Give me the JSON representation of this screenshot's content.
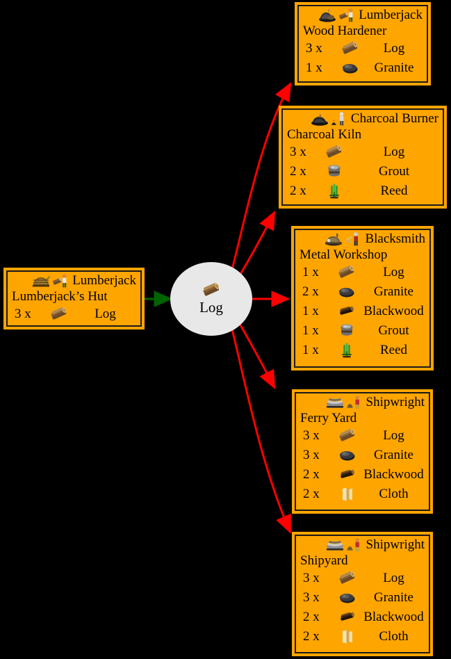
{
  "diagram": {
    "type": "production-chain",
    "background": "#000000",
    "node_fill": "#ffa500",
    "hub_fill": "#e8e8e8",
    "producer_edge_color": "#006400",
    "consumer_edge_color": "#ff0000",
    "hub": {
      "label": "Log",
      "icon": "log-icon"
    }
  },
  "producers": [
    {
      "id": "lumberjacks-hut",
      "worker": "Lumberjack",
      "building": "Lumberjack’s Hut",
      "worker_icons": [
        "lumberjacks-hut-icon",
        "lumberjack-worker-icon"
      ],
      "items": [
        {
          "qty": "3 x",
          "icon": "log-icon",
          "name": "Log"
        }
      ]
    }
  ],
  "consumers": [
    {
      "id": "wood-hardener",
      "worker": "Lumberjack",
      "building": "Wood Hardener",
      "worker_icons": [
        "wood-hardener-icon",
        "lumberjack-worker-icon"
      ],
      "items": [
        {
          "qty": "3 x",
          "icon": "log-icon",
          "name": "Log"
        },
        {
          "qty": "1 x",
          "icon": "granite-icon",
          "name": "Granite"
        }
      ]
    },
    {
      "id": "charcoal-kiln",
      "worker": "Charcoal Burner",
      "building": "Charcoal Kiln",
      "worker_icons": [
        "charcoal-kiln-icon",
        "charcoal-burner-worker-icon"
      ],
      "items": [
        {
          "qty": "3 x",
          "icon": "log-icon",
          "name": "Log"
        },
        {
          "qty": "2 x",
          "icon": "grout-icon",
          "name": "Grout"
        },
        {
          "qty": "2 x",
          "icon": "reed-icon",
          "name": "Reed"
        }
      ]
    },
    {
      "id": "metal-workshop",
      "worker": "Blacksmith",
      "building": "Metal Workshop",
      "worker_icons": [
        "metal-workshop-icon",
        "blacksmith-worker-icon"
      ],
      "items": [
        {
          "qty": "1 x",
          "icon": "log-icon",
          "name": "Log"
        },
        {
          "qty": "2 x",
          "icon": "granite-icon",
          "name": "Granite"
        },
        {
          "qty": "1 x",
          "icon": "blackwood-icon",
          "name": "Blackwood"
        },
        {
          "qty": "1 x",
          "icon": "grout-icon",
          "name": "Grout"
        },
        {
          "qty": "1 x",
          "icon": "reed-icon",
          "name": "Reed"
        }
      ]
    },
    {
      "id": "ferry-yard",
      "worker": "Shipwright",
      "building": "Ferry Yard",
      "worker_icons": [
        "ferry-yard-icon",
        "shipwright-worker-icon"
      ],
      "items": [
        {
          "qty": "3 x",
          "icon": "log-icon",
          "name": "Log"
        },
        {
          "qty": "3 x",
          "icon": "granite-icon",
          "name": "Granite"
        },
        {
          "qty": "2 x",
          "icon": "blackwood-icon",
          "name": "Blackwood"
        },
        {
          "qty": "2 x",
          "icon": "cloth-icon",
          "name": "Cloth"
        }
      ]
    },
    {
      "id": "shipyard",
      "worker": "Shipwright",
      "building": "Shipyard",
      "worker_icons": [
        "shipyard-icon",
        "shipwright-worker-icon"
      ],
      "items": [
        {
          "qty": "3 x",
          "icon": "log-icon",
          "name": "Log"
        },
        {
          "qty": "3 x",
          "icon": "granite-icon",
          "name": "Granite"
        },
        {
          "qty": "2 x",
          "icon": "blackwood-icon",
          "name": "Blackwood"
        },
        {
          "qty": "2 x",
          "icon": "cloth-icon",
          "name": "Cloth"
        }
      ]
    }
  ]
}
